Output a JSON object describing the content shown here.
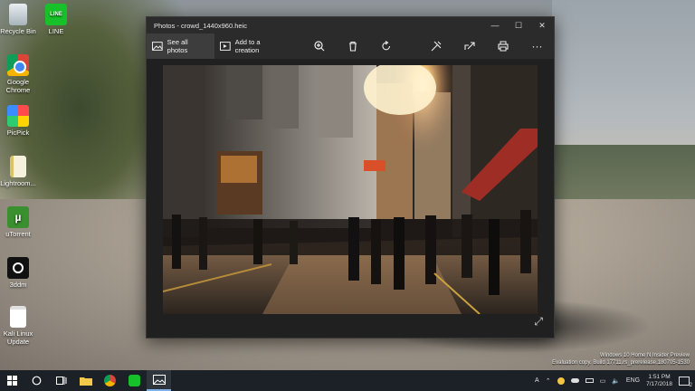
{
  "desktop": {
    "icons": [
      {
        "label": "Recycle Bin",
        "icon": "recycle-bin-icon"
      },
      {
        "label": "LINE",
        "icon": "line-icon",
        "glyph": "LINE"
      },
      {
        "label": "Google Chrome",
        "icon": "chrome-icon"
      },
      {
        "label": "PicPick",
        "icon": "picpick-icon"
      },
      {
        "label": "Lightroom...",
        "icon": "file-icon"
      },
      {
        "label": "uTorrent",
        "icon": "utorrent-icon",
        "glyph": "µ"
      },
      {
        "label": "3ddm",
        "icon": "camera-icon"
      },
      {
        "label": "Kali Linux Update",
        "icon": "document-icon"
      }
    ]
  },
  "window": {
    "title": "Photos - crowd_1440x960.heic",
    "controls": {
      "minimize": "—",
      "maximize": "☐",
      "close": "✕"
    }
  },
  "toolbar": {
    "see_all_photos": "See all photos",
    "add_to_creation": "Add to a creation",
    "more": "···"
  },
  "taskbar": {
    "tray_ime": "A",
    "tray_lang": "ENG"
  },
  "clock": {
    "time": "1:51 PM",
    "date": "7/17/2018"
  },
  "notification_count": "2",
  "watermark": {
    "line1": "Windows 10 Home N Insider Preview",
    "line2": "Evaluation copy. Build 17711.rs_prerelease.180705-1530"
  },
  "colors": {
    "accent": "#7fb1e6",
    "window_bg": "#2b2b2b",
    "viewer_bg": "#202020"
  }
}
